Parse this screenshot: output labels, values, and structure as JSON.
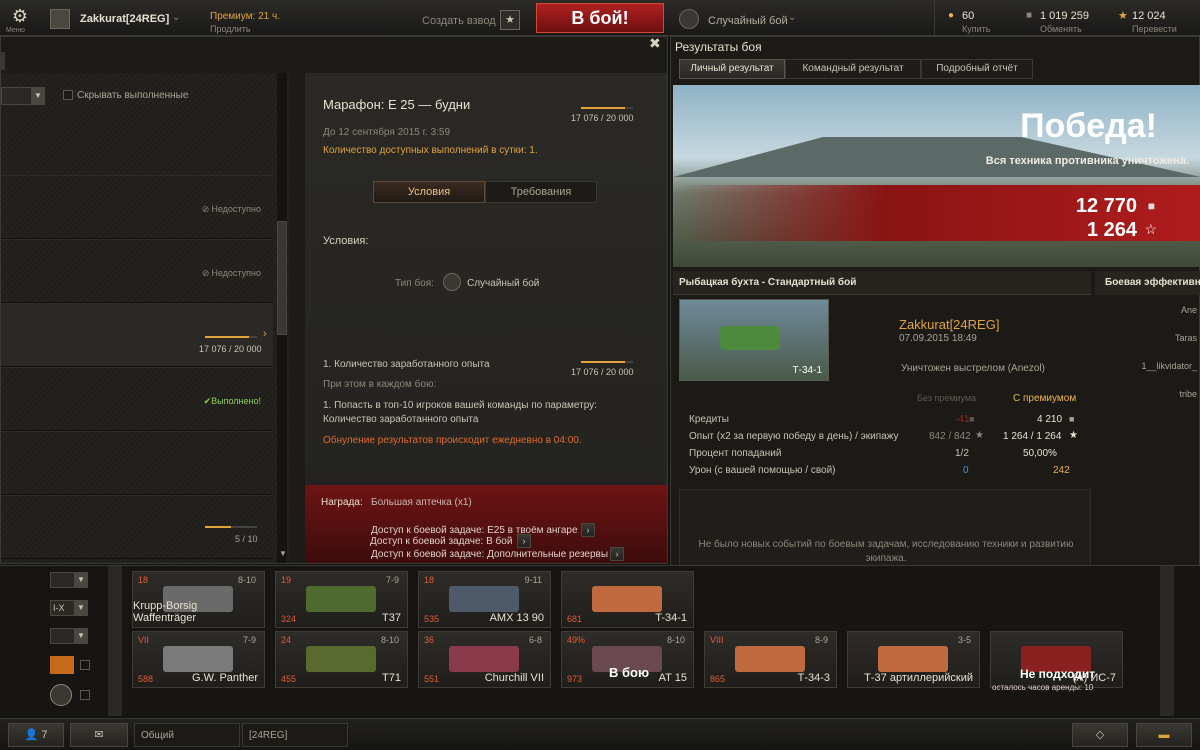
{
  "topbar": {
    "menu_label": "Меню",
    "username": "Zakkurat[24REG]",
    "premium": "Премиум: 21 ч.",
    "premium_sub": "Продлить",
    "create_platoon": "Создать взвод",
    "battle_button": "В бой!",
    "battle_mode": "Случайный бой",
    "gold_value": "60",
    "gold_action": "Купить",
    "credits_value": "1 019 259",
    "credits_action": "Обменять",
    "free_xp_value": "12 024",
    "free_xp_action": "Перевести"
  },
  "missions": {
    "hide_done_label": "Скрывать выполненные",
    "status_unavailable_1": "Недоступно",
    "status_unavailable_2": "Недоступно",
    "progress_row": "17 076 / 20 000",
    "status_done": "Выполнено!",
    "counter_bottom": "5 / 10"
  },
  "detail": {
    "title": "Марафон: Е 25 — будни",
    "progress": "17 076 / 20 000",
    "date": "До 12 сентября 2015 г. 3:59",
    "daily_limit": "Количество доступных выполнений в сутки: 1.",
    "tab_conditions": "Условия",
    "tab_requirements": "Требования",
    "conditions_header": "Условия:",
    "battle_type_label": "Тип боя:",
    "battle_type_value": "Случайный бой",
    "cond1": "1. Количество заработанного опыта",
    "cond1_progress": "17 076 / 20 000",
    "each_battle": "При этом в каждом бою:",
    "cond2": "1. Попасть в топ-10 игроков вашей команды по параметру: Количество заработанного опыта",
    "reset_note": "Обнуление результатов происходит ежедневно в 04:00.",
    "reward_label": "Награда:",
    "reward_value": "Большая аптечка (x1)",
    "access1": "Доступ к боевой задаче: Е25 в твоём ангаре",
    "access2": "Доступ к боевой задаче: Дополнительные резервы",
    "access3": "Доступ к боевой задаче: В бой"
  },
  "results": {
    "window_title": "Результаты боя",
    "tab_personal": "Личный результат",
    "tab_team": "Командный результат",
    "tab_detailed": "Подробный отчёт",
    "victory": "Победа!",
    "victory_sub": "Вся техника противника уничтожена.",
    "credits_total": "12 770",
    "xp_total": "1 264",
    "map_mode": "Рыбацкая бухта - Стандартный бой",
    "efficiency_header": "Боевая эффективн",
    "player": "Zakkurat[24REG]",
    "datetime": "07.09.2015 18:49",
    "tank_name": "Т-34-1",
    "destroyed_by": "Уничтожен выстрелом (Anezol)",
    "col_no_premium": "Без премиума",
    "col_premium": "С премиумом",
    "rows": [
      {
        "label": "Кредиты",
        "base": "-41",
        "prem": "4 210"
      },
      {
        "label": "Опыт  (x2 за первую победу в день) / экипажу",
        "base": "842 / 842",
        "prem": "1 264 / 1 264"
      },
      {
        "label": "Процент попаданий",
        "base": "1/2",
        "prem": "50,00%"
      },
      {
        "label": "Урон (с вашей помощью / свой)",
        "base": "0",
        "prem": "242"
      }
    ],
    "no_events": "Не было новых событий по боевым задачам, исследованию техники и развитию экипажа.",
    "eff_names": [
      "Ane",
      "Taras",
      "1__likvidator_",
      "tribe"
    ]
  },
  "filters": {
    "level": "I-X"
  },
  "carousel": [
    {
      "name": "Krupp-Borsig Waffenträger",
      "level": "8-10",
      "c1": "18",
      "c2": "",
      "col": 0,
      "row": 0
    },
    {
      "name": "T37",
      "level": "7-9",
      "c1": "19",
      "c2": "324",
      "col": 1,
      "row": 0
    },
    {
      "name": "AMX 13 90",
      "level": "9-11",
      "c1": "18",
      "c2": "535",
      "col": 2,
      "row": 0
    },
    {
      "name": "T-34-1",
      "level": "",
      "c1": "",
      "c2": "681",
      "col": 3,
      "row": 0
    },
    {
      "name": "G.W. Panther",
      "level": "7-9",
      "c1": "VII",
      "c2": "588",
      "col": 0,
      "row": 1
    },
    {
      "name": "T71",
      "level": "8-10",
      "c1": "24",
      "c2": "455",
      "col": 1,
      "row": 1
    },
    {
      "name": "Churchill VII",
      "level": "6-8",
      "c1": "36",
      "c2": "551",
      "col": 2,
      "row": 1
    },
    {
      "name": "AT 15",
      "level": "8-10",
      "c1": "49%",
      "c2": "973",
      "col": 3,
      "row": 1
    },
    {
      "name": "Т-34-3",
      "level": "8-9",
      "c1": "VIII",
      "c2": "865",
      "col": 4,
      "row": 1
    },
    {
      "name": "Т-37 артиллерийский",
      "level": "3-5",
      "c1": "",
      "c2": "",
      "col": 5,
      "row": 1
    },
    {
      "name": "(А) ИС-7",
      "level": "",
      "c1": "",
      "c2": "",
      "col": 6,
      "row": 1
    }
  ],
  "carousel_overlays": {
    "in_battle": "В бою",
    "not_fit": "Не подходит",
    "not_fit_sub": "осталось часов аренды: 10"
  },
  "bottombar": {
    "friends_count": "7",
    "channel_general": "Общий",
    "channel_clan": "[24REG]"
  },
  "colors": {
    "accent": "#e0a43b",
    "victory_red": "#a01c1c",
    "battle_button": "#8f1616"
  }
}
